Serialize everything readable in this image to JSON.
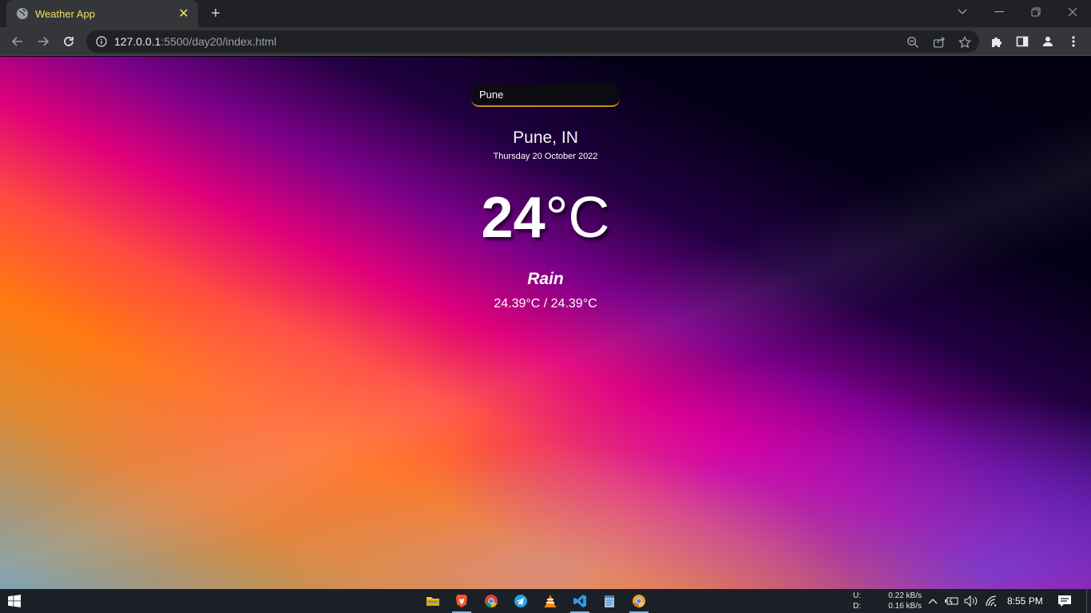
{
  "browser": {
    "tab_title": "Weather App",
    "new_tab_label": "+",
    "url_host": "127.0.0.1",
    "url_rest": ":5500/day20/index.html"
  },
  "weather": {
    "search_value": "Pune",
    "location": "Pune, IN",
    "date": "Thursday 20 October 2022",
    "temp_value": "24",
    "temp_unit": "°C",
    "condition": "Rain",
    "hi_low": "24.39°C / 24.39°C"
  },
  "taskbar": {
    "apps": [
      "file-explorer",
      "brave",
      "chrome",
      "telegram",
      "vlc",
      "vscode",
      "notepad",
      "chrome-canary"
    ],
    "net_up_label": "U:",
    "net_down_label": "D:",
    "net_up_value": "0.22 kB/s",
    "net_down_value": "0.16 kB/s",
    "time": "8:55 PM"
  },
  "colors": {
    "tab_text": "#f1e05a",
    "search_underline": "#d08a1a",
    "chrome_dark": "#202124",
    "chrome_mid": "#35363a",
    "taskbar": "#1b1f26"
  }
}
